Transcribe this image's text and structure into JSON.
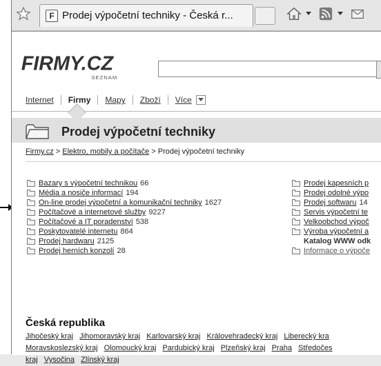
{
  "browser": {
    "tab_title": "Prodej výpočetní techniky - Česká r...",
    "favicon_letter": "F"
  },
  "header": {
    "logo_text": "FIRMY.CZ",
    "logo_sub": "SEZNAM",
    "nav": {
      "internet": "Internet",
      "firmy": "Firmy",
      "mapy": "Mapy",
      "zbozi": "Zboží",
      "vice": "Více"
    }
  },
  "page_title": "Prodej výpočetní techniky",
  "breadcrumb": {
    "home": "Firmy.cz",
    "sep1": " > ",
    "category": "Elektro, mobily a počítače",
    "sep2": " > ",
    "current": "Prodej výpočetní techniky"
  },
  "categories_left": [
    {
      "label": "Bazary s výpočetní technikou",
      "count": "66"
    },
    {
      "label": "Média a nosiče informací",
      "count": "194"
    },
    {
      "label": "On-line prodej výpočetní a komunikační techniky",
      "count": "1627"
    },
    {
      "label": "Počítačové a internetové služby",
      "count": "9227"
    },
    {
      "label": "Počítačové a IT poradenství",
      "count": "538"
    },
    {
      "label": "Poskytovatelé internetu",
      "count": "864"
    },
    {
      "label": "Prodej hardwaru",
      "count": "2125"
    },
    {
      "label": "Prodej herních konzolí",
      "count": "28"
    }
  ],
  "categories_right": [
    {
      "label": "Prodej kapesních p",
      "count": ""
    },
    {
      "label": "Prodej odolné výpo",
      "count": ""
    },
    {
      "label": "Prodej softwaru",
      "count": "14"
    },
    {
      "label": "Servis výpočetní te",
      "count": ""
    },
    {
      "label": "Velkoobchod výpoč",
      "count": ""
    },
    {
      "label": "Výroba výpočetní a",
      "count": ""
    }
  ],
  "catalog_label": "Katalog WWW odk",
  "info_link": "Informace o výpoče",
  "region": {
    "title": "Česká republika",
    "links": [
      "Jihočeský kraj",
      "Jihomoravský kraj",
      "Karlovarský kraj",
      "Královehradecký kraj",
      "Liberecký kra",
      "Moravskoslezský kraj",
      "Olomoucký kraj",
      "Pardubický kraj",
      "Plzeňský kraj",
      "Praha",
      "Středočes",
      "kraj",
      "Vysočina",
      "Zlínský kraj"
    ]
  },
  "colors": {
    "page_bg": "#ffffff",
    "band_bg": "#e0e0e0",
    "link": "#222222"
  }
}
